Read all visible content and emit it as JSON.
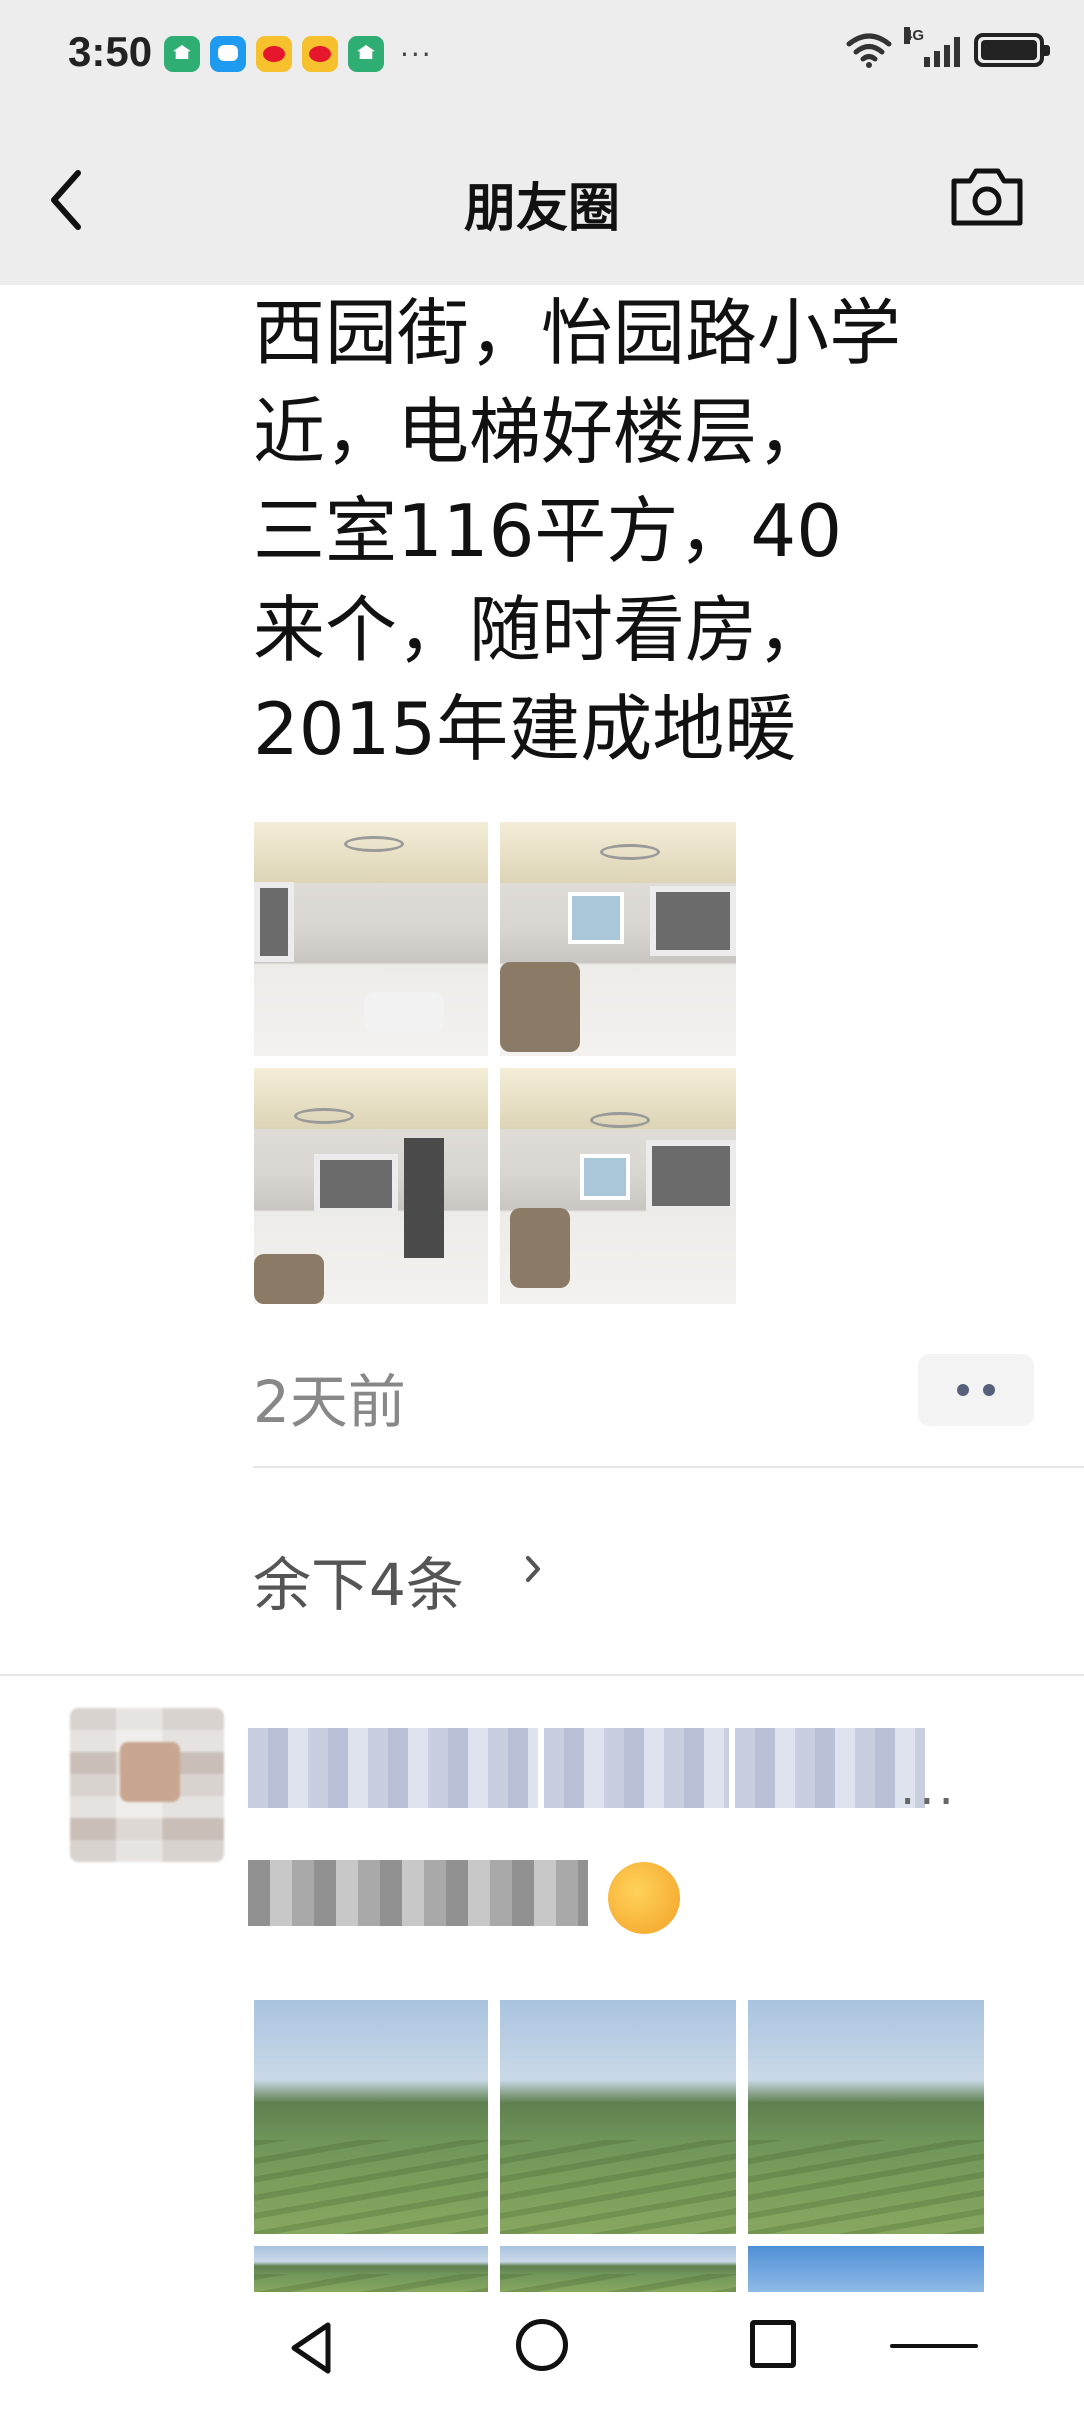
{
  "status_bar": {
    "time": "3:50",
    "more": "···",
    "network": "4G",
    "app_icons": [
      "home-app-icon",
      "message-app-icon",
      "weibo-icon",
      "weibo-icon",
      "home-app-icon"
    ]
  },
  "header": {
    "title": "朋友圈",
    "back_icon": "chevron-left-icon",
    "camera_icon": "camera-icon"
  },
  "post": {
    "text": "西园街，怡园路小学\n近，电梯好楼层，\n三室116平方，40\n来个，随时看房，\n2015年建成地暖",
    "images": [
      "living-room-photo",
      "living-room-photo",
      "living-room-photo",
      "living-room-photo"
    ],
    "time": "2天前",
    "remaining": "余下4条"
  },
  "next_post": {
    "more": "..."
  },
  "colors": {
    "bar_bg": "#ededed",
    "name_link": "#576b95",
    "timestamp": "#888888"
  }
}
